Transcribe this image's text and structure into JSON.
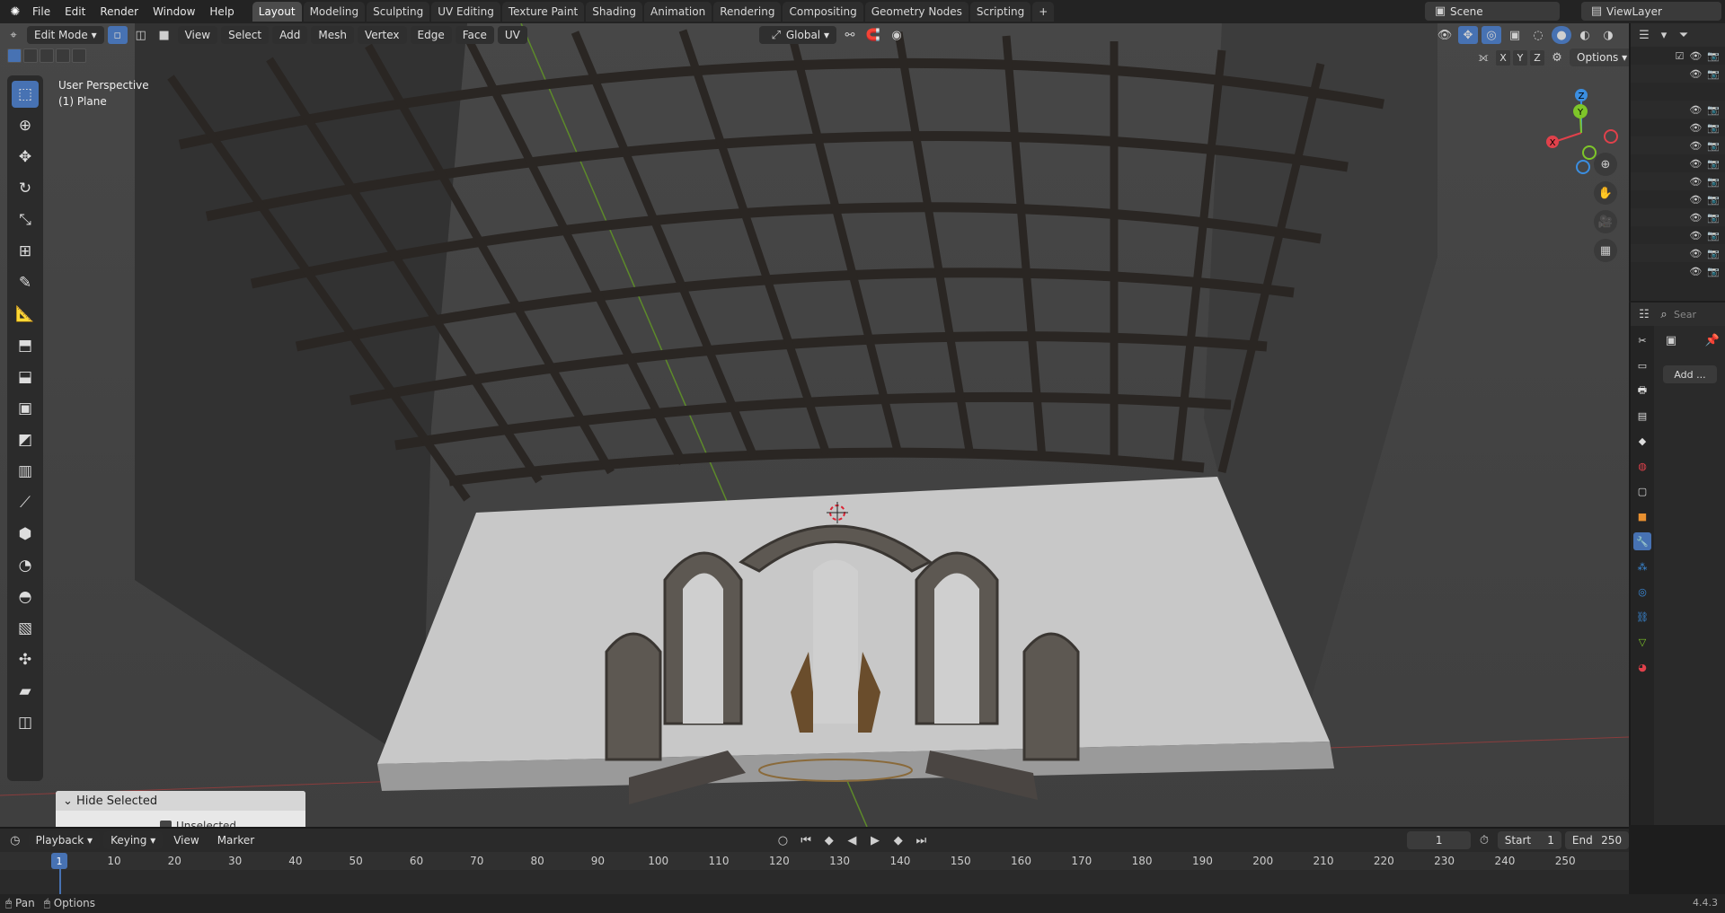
{
  "top_menu": [
    "File",
    "Edit",
    "Render",
    "Window",
    "Help"
  ],
  "workspace_tabs": [
    {
      "label": "Layout",
      "active": true
    },
    {
      "label": "Modeling"
    },
    {
      "label": "Sculpting"
    },
    {
      "label": "UV Editing"
    },
    {
      "label": "Texture Paint"
    },
    {
      "label": "Shading"
    },
    {
      "label": "Animation"
    },
    {
      "label": "Rendering"
    },
    {
      "label": "Compositing"
    },
    {
      "label": "Geometry Nodes"
    },
    {
      "label": "Scripting"
    }
  ],
  "scene": {
    "name": "Scene"
  },
  "view_layer": {
    "name": "ViewLayer"
  },
  "viewport_header": {
    "mode": "Edit Mode",
    "menus": [
      "View",
      "Select",
      "Add",
      "Mesh",
      "Vertex",
      "Edge",
      "Face",
      "UV"
    ],
    "orientation": "Global",
    "options": "Options",
    "axes": [
      "X",
      "Y",
      "Z"
    ]
  },
  "viewport_info": {
    "perspective": "User Perspective",
    "object": "(1) Plane"
  },
  "gizmo_axes": {
    "x": "X",
    "y": "Y",
    "z": "Z"
  },
  "colors": {
    "accent": "#4772b3",
    "x_axis": "#e0414b",
    "y_axis": "#7ec629",
    "z_axis": "#3b8ee0"
  },
  "tools": [
    "select-box",
    "cursor",
    "move",
    "rotate",
    "scale",
    "transform",
    "annotate",
    "measure",
    "add-cube",
    "extrude",
    "inset",
    "bevel",
    "loop-cut",
    "knife",
    "poly-build",
    "spin",
    "smooth",
    "edge-slide",
    "shrink-fatten",
    "shear",
    "rip"
  ],
  "operator_panel": {
    "title": "Hide Selected",
    "option": "Unselected"
  },
  "properties": {
    "add_modifier": "Add ...",
    "search_placeholder": "Sear"
  },
  "timeline": {
    "menus": [
      "Playback",
      "Keying",
      "View",
      "Marker"
    ],
    "current_frame": "1",
    "start_label": "Start",
    "start": "1",
    "end_label": "End",
    "end": "250",
    "ruler": [
      "1",
      "10",
      "20",
      "30",
      "40",
      "50",
      "60",
      "70",
      "80",
      "90",
      "100",
      "110",
      "120",
      "130",
      "140",
      "150",
      "160",
      "170",
      "180",
      "190",
      "200",
      "210",
      "220",
      "230",
      "240",
      "250"
    ]
  },
  "status": {
    "left1": "Pan",
    "left2": "Options",
    "version": "4.4.3"
  }
}
